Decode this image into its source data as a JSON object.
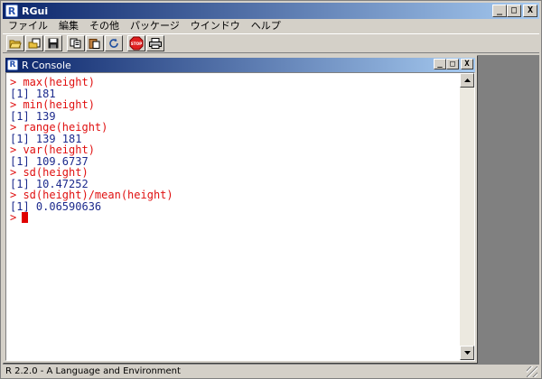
{
  "app": {
    "title": "RGui",
    "logo_letter": "R",
    "window_buttons": {
      "minimize": "_",
      "maximize": "□",
      "close": "X"
    }
  },
  "menu": [
    "ファイル",
    "編集",
    "その他",
    "パッケージ",
    "ウインドウ",
    "ヘルプ"
  ],
  "toolbar": {
    "buttons": [
      "open-script",
      "load-workspace",
      "save-workspace",
      "copy",
      "paste",
      "copy-paste",
      "stop",
      "print"
    ],
    "stop_label": "STOP"
  },
  "console": {
    "title": "R Console",
    "logo_letter": "R",
    "lines": [
      {
        "type": "cmd",
        "text": "> max(height)"
      },
      {
        "type": "out",
        "text": "[1] 181"
      },
      {
        "type": "cmd",
        "text": "> min(height)"
      },
      {
        "type": "out",
        "text": "[1] 139"
      },
      {
        "type": "cmd",
        "text": "> range(height)"
      },
      {
        "type": "out",
        "text": "[1] 139 181"
      },
      {
        "type": "cmd",
        "text": "> var(height)"
      },
      {
        "type": "out",
        "text": "[1] 109.6737"
      },
      {
        "type": "cmd",
        "text": "> sd(height)"
      },
      {
        "type": "out",
        "text": "[1] 10.47252"
      },
      {
        "type": "cmd",
        "text": "> sd(height)/mean(height)"
      },
      {
        "type": "out",
        "text": "[1] 0.06590636"
      }
    ],
    "prompt": ">"
  },
  "status": {
    "text": "R 2.2.0 - A Language and Environment"
  },
  "colors": {
    "command": "#e01010",
    "output": "#1c2a8c",
    "titlebar_start": "#0a246a",
    "titlebar_end": "#a6caf0"
  }
}
